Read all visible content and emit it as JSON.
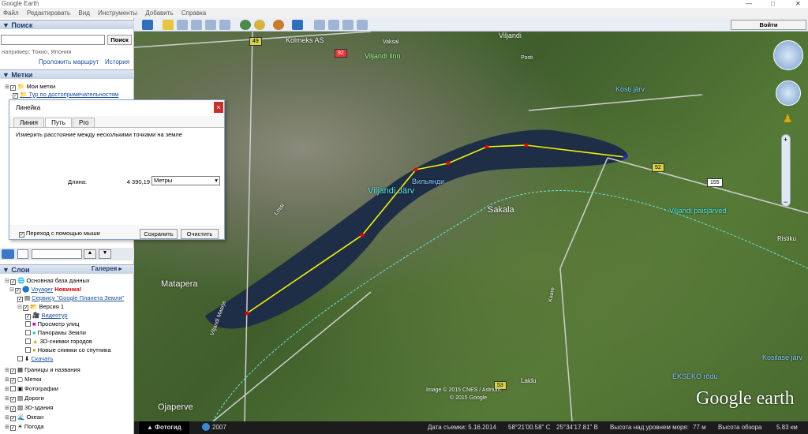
{
  "window": {
    "title": "Google Earth"
  },
  "menu": [
    "Файл",
    "Редактировать",
    "Вид",
    "Инструменты",
    "Добавить",
    "Справка"
  ],
  "search": {
    "header": "Поиск",
    "button": "Поиск",
    "hint": "например: Токио, Япония",
    "route_link": "Проложить маршрут",
    "history_link": "История"
  },
  "places": {
    "header": "Метки",
    "items": [
      "Мои метки",
      "Тур по достопримечательностям"
    ]
  },
  "ruler": {
    "title": "Линейка",
    "tabs": [
      "Линия",
      "Путь",
      "Pro"
    ],
    "desc": "Измерить расстояние между несколькими точками на земле",
    "length_label": "Длина:",
    "length_value": "4 390,19",
    "unit": "Метры",
    "mouse_nav": "Переход с помощью мыши",
    "save": "Сохранить",
    "clear": "Очистить"
  },
  "layers": {
    "header": "Слои",
    "gallery": "Галерея",
    "items": [
      {
        "text": "Основная база данных",
        "level": 0
      },
      {
        "text": "Voyager",
        "badge": "Новинка!",
        "level": 1
      },
      {
        "text": "Сервису \"Google Планета Земля\"",
        "level": 2
      },
      {
        "text": "Версия 1",
        "level": 2
      },
      {
        "text": "Видеотур",
        "level": 3
      },
      {
        "text": "Просмотр улиц",
        "level": 3
      },
      {
        "text": "Панорамы Земли",
        "level": 3
      },
      {
        "text": "3D-снимки городов",
        "level": 3
      },
      {
        "text": "Новые снимки со спутника",
        "level": 3
      },
      {
        "text": "Скачать",
        "level": 2
      },
      {
        "text": "Границы и названия",
        "level": 0
      },
      {
        "text": "Метки",
        "level": 0
      },
      {
        "text": "Фотографии",
        "level": 0
      },
      {
        "text": "Дороги",
        "level": 0
      },
      {
        "text": "3D-здания",
        "level": 0
      },
      {
        "text": "Океан",
        "level": 0
      },
      {
        "text": "Погода",
        "level": 0
      }
    ]
  },
  "toolbar": {
    "signin": "Войти"
  },
  "map": {
    "labels": [
      "Viljandi",
      "Kolmeks AS",
      "Viljandi linn",
      "Vaksal",
      "Posti",
      "Kosti järv",
      "Viljandi Järv",
      "Вильянди",
      "Sakala",
      "Viljandi paisjärved",
      "Ristiku",
      "Matapera",
      "Ojaperve",
      "Laidu",
      "EKSEKO rõdu",
      "Kosilase järv",
      "Lossi",
      "Viljandi Maarja",
      "Kaare"
    ],
    "roads": [
      "49",
      "92",
      "52",
      "155",
      "53"
    ],
    "copyright": [
      "Image © 2015 CNES / Astrium",
      "© 2015 Google"
    ],
    "logo": "Google earth"
  },
  "status": {
    "photo_tab": "Фотогид",
    "year": "2007",
    "date": "Дата съемки: 5.16.2014",
    "lat": "58°21'00.58\" С",
    "lon": "25°34'17.81\" В",
    "elev_label": "Высота над уровнем моря:",
    "elev": "77 м",
    "eye_label": "Высота обзора",
    "eye": "5.83 км"
  }
}
